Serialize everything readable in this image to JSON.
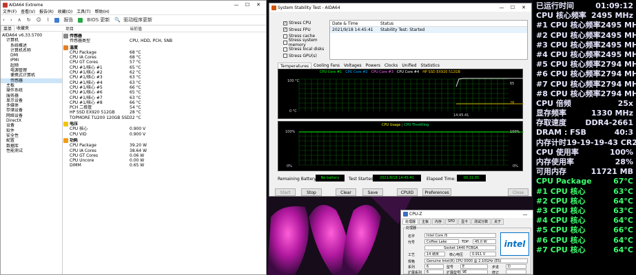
{
  "aida": {
    "title": "AIDA64 Extreme",
    "menu": [
      "菜单",
      "收藏夹",
      "文件(F)",
      "查看(V)",
      "报告(R)",
      "收藏(O)",
      "工具(T)",
      "帮助(H)"
    ],
    "toolbar": {
      "report": "报告",
      "bios": "BIOS 更新",
      "driver": "驱动程序更新"
    },
    "tabs": [
      "菜单",
      "收藏夹"
    ],
    "cols": [
      "项目",
      "当前值"
    ],
    "tree": [
      "AIDA64 v6.33.5700",
      "计算机",
      "系统概述",
      "计算机名称",
      "DMI",
      "IPMI",
      "超频",
      "电源管理",
      "便携式计算机",
      "传感器",
      "主板",
      "操作系统",
      "服务器",
      "显示设备",
      "多媒体",
      "存储设备",
      "网络设备",
      "DirectX",
      "设备",
      "软件",
      "安全性",
      "配置",
      "数据库",
      "性能测试"
    ],
    "sensor_section": "传感器",
    "sensor_type_label": "传感器类型",
    "sensor_type_value": "CPU, HDD, PCH, SNB",
    "temp_section": "温度",
    "temps": [
      [
        "CPU Package",
        "68 °C"
      ],
      [
        "CPU IA Cores",
        "68 °C"
      ],
      [
        "CPU GT Cores",
        "57 °C"
      ],
      [
        "CPU #1/核心 #1",
        "65 °C"
      ],
      [
        "CPU #1/核心 #2",
        "62 °C"
      ],
      [
        "CPU #1/核心 #3",
        "63 °C"
      ],
      [
        "CPU #1/核心 #4",
        "63 °C"
      ],
      [
        "CPU #1/核心 #5",
        "66 °C"
      ],
      [
        "CPU #1/核心 #6",
        "65 °C"
      ],
      [
        "CPU #1/核心 #7",
        "63 °C"
      ],
      [
        "CPU #1/核心 #8",
        "66 °C"
      ],
      [
        "PCH 二极管",
        "54 °C"
      ],
      [
        "HP SSD EX920 512GB",
        "28 °C"
      ],
      [
        "TOPMORE TU200 120GB SSD",
        "32 °C"
      ]
    ],
    "volt_section": "电压",
    "volts": [
      [
        "CPU 核心",
        "0.900 V"
      ],
      [
        "CPU VID",
        "0.900 V"
      ]
    ],
    "power_section": "功耗",
    "powers": [
      [
        "CPU Package",
        "39.20 W"
      ],
      [
        "CPU IA Cores",
        "38.64 W"
      ],
      [
        "CPU GT Cores",
        "0.06 W"
      ],
      [
        "CPU Uncore",
        "0.00 W"
      ],
      [
        "DIMM",
        "0.65 W"
      ]
    ]
  },
  "stab": {
    "title": "System Stability Test - AIDA64",
    "checks": [
      {
        "label": "Stress CPU",
        "on": true
      },
      {
        "label": "Stress FPU",
        "on": true
      },
      {
        "label": "Stress cache",
        "on": false
      },
      {
        "label": "Stress system memory",
        "on": false
      },
      {
        "label": "Stress local disks",
        "on": false
      },
      {
        "label": "Stress GPU(s)",
        "on": false
      }
    ],
    "log_headers": [
      "Date & Time",
      "Status"
    ],
    "log_date": "2021/9/18 14:45:41",
    "log_status": "Stability Test: Started",
    "tabs": [
      "Temperatures",
      "Cooling Fans",
      "Voltages",
      "Powers",
      "Clocks",
      "Unified",
      "Statistics"
    ],
    "legend": [
      "CPU Core #1",
      "CPU Core #2",
      "CPU Core #3",
      "CPU Core #4",
      "HP SSD EX920 512GB"
    ],
    "temp_top": "100 °C",
    "temp_bot": "0 °C",
    "temp_time": "14:45:41",
    "temp_v1": "65",
    "temp_v2": "28",
    "usage_title": "CPU Usage",
    "usage_sep": "|",
    "usage_throttle": "CPU Throttling",
    "usage_top": "100%",
    "usage_bot": "0%",
    "usage_r_top": "100%",
    "usage_r_bot": "0%",
    "remaining_label": "Remaining Battery:",
    "remaining_value": "No battery",
    "started_label": "Test Started:",
    "started_value": "2021/9/18 14:45:41",
    "elapsed_label": "Elapsed Time:",
    "elapsed_value": "00:11:05",
    "buttons": [
      "Start",
      "Stop",
      "Clear",
      "Save",
      "CPUID",
      "Preferences",
      "Close"
    ]
  },
  "panel": {
    "rows": [
      {
        "k": "已运行时间",
        "v": "01:09:12",
        "c": "#e6e6ff"
      },
      {
        "k": "CPU 核心频率",
        "v": "2495 MHz",
        "c": "#e6e6ff"
      },
      {
        "k": "#1 CPU 核心频率",
        "v": "2495 MHz",
        "c": "#e6e6ff"
      },
      {
        "k": "#2 CPU 核心频率",
        "v": "2495 MHz",
        "c": "#e6e6ff"
      },
      {
        "k": "#3 CPU 核心频率",
        "v": "2495 MHz",
        "c": "#e6e6ff"
      },
      {
        "k": "#4 CPU 核心频率",
        "v": "2495 MHz",
        "c": "#e6e6ff"
      },
      {
        "k": "#5 CPU 核心频率",
        "v": "2794 MHz",
        "c": "#e6e6ff"
      },
      {
        "k": "#6 CPU 核心频率",
        "v": "2794 MHz",
        "c": "#e6e6ff"
      },
      {
        "k": "#7 CPU 核心频率",
        "v": "2794 MHz",
        "c": "#e6e6ff"
      },
      {
        "k": "#8 CPU 核心频率",
        "v": "2794 MHz",
        "c": "#e6e6ff"
      },
      {
        "k": "CPU 倍频",
        "v": "25x",
        "c": "#e6e6ff"
      },
      {
        "k": "显存频率",
        "v": "1330 MHz",
        "c": "#e6e6ff"
      },
      {
        "k": "存取速度",
        "v": "DDR4-2661",
        "c": "#e6e6ff"
      },
      {
        "k": "DRAM : FSB",
        "v": "40:3",
        "c": "#e6e6ff"
      },
      {
        "k": "内存计时",
        "v": "19-19-19-43 CR2",
        "c": "#e6e6ff"
      },
      {
        "k": "CPU 使用率",
        "v": "100%",
        "c": "#e6e6ff"
      },
      {
        "k": "内存使用率",
        "v": "28%",
        "c": "#e6e6ff"
      },
      {
        "k": "可用内存",
        "v": "11721 MB",
        "c": "#e6e6ff"
      },
      {
        "k": "CPU Package",
        "v": "67°C",
        "c": "#3cff6e"
      },
      {
        "k": "#1 CPU 核心",
        "v": "63°C",
        "c": "#3cff6e"
      },
      {
        "k": "#2 CPU 核心",
        "v": "64°C",
        "c": "#3cff6e"
      },
      {
        "k": "#3 CPU 核心",
        "v": "63°C",
        "c": "#3cff6e"
      },
      {
        "k": "#4 CPU 核心",
        "v": "64°C",
        "c": "#3cff6e"
      },
      {
        "k": "#5 CPU 核心",
        "v": "66°C",
        "c": "#3cff6e"
      },
      {
        "k": "#6 CPU 核心",
        "v": "64°C",
        "c": "#3cff6e"
      },
      {
        "k": "#7 CPU 核心",
        "v": "64°C",
        "c": "#3cff6e"
      }
    ]
  },
  "cpuz": {
    "title": "CPU-Z",
    "tabs": [
      "处理器",
      "主板",
      "内存",
      "SPD",
      "显卡",
      "测试分数",
      "关于"
    ],
    "group": "处理器",
    "name_label": "名字",
    "name": "Intel Core i5",
    "code_label": "代号",
    "code": "Coffee Lake",
    "tdp_label": "TDP",
    "tdp": "45.0 W",
    "socket": "Socket 1440 FCBGA",
    "tech_label": "工艺",
    "tech": "14 纳米",
    "volt_label": "核心电压",
    "volt": "0.911 V",
    "spec_label": "规格",
    "spec": "Genuine Intel(R) CPU 0000 @ 2.10GHz (ES)",
    "family_label": "系列",
    "family": "6",
    "model_label": "型号",
    "model": "E",
    "step_label": "步进",
    "step": "D",
    "ext_label": "扩展系列",
    "ext": "6",
    "extm_label": "扩展型号",
    "extm": "9E",
    "rev_label": "修订",
    "rev": "",
    "logo": "intel"
  }
}
